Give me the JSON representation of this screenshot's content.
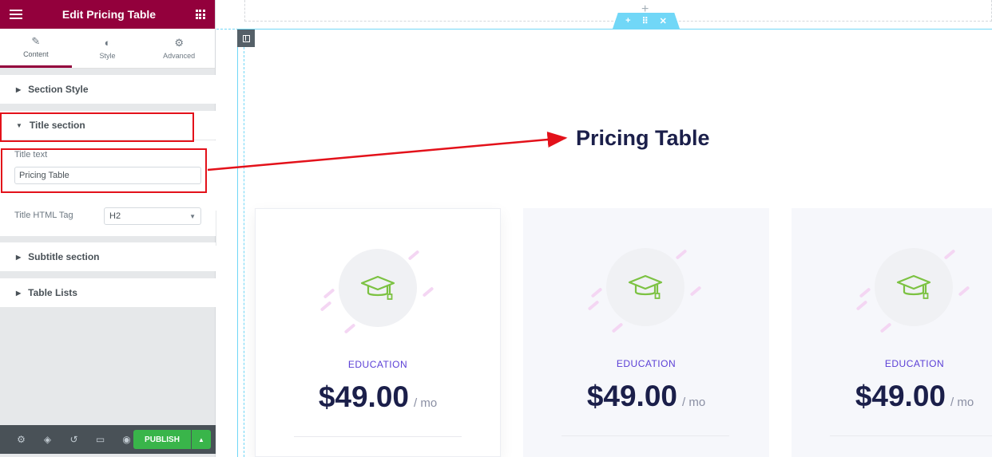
{
  "panel": {
    "title": "Edit Pricing Table",
    "tabs": [
      {
        "label": "Content",
        "icon": "pencil-icon"
      },
      {
        "label": "Style",
        "icon": "half-circle-icon"
      },
      {
        "label": "Advanced",
        "icon": "gear-icon"
      }
    ],
    "sections": {
      "section_style": "Section Style",
      "title_section": "Title section",
      "subtitle_section": "Subtitle section",
      "table_lists": "Table Lists"
    },
    "controls": {
      "title_text_label": "Title text",
      "title_text_value": "Pricing Table",
      "title_tag_label": "Title HTML Tag",
      "title_tag_value": "H2"
    },
    "footer": {
      "publish_label": "PUBLISH"
    }
  },
  "canvas": {
    "heading": "Pricing Table",
    "cards": [
      {
        "category": "EDUCATION",
        "price": "$49.00",
        "period": "/ mo"
      },
      {
        "category": "EDUCATION",
        "price": "$49.00",
        "period": "/ mo"
      },
      {
        "category": "EDUCATION",
        "price": "$49.00",
        "period": "/ mo"
      }
    ]
  },
  "colors": {
    "brand": "#93003c",
    "publish": "#39b54a",
    "highlight": "#e3111a",
    "category": "#5b3fd6",
    "icon_green": "#7cc242",
    "selection": "#71d7f7"
  }
}
